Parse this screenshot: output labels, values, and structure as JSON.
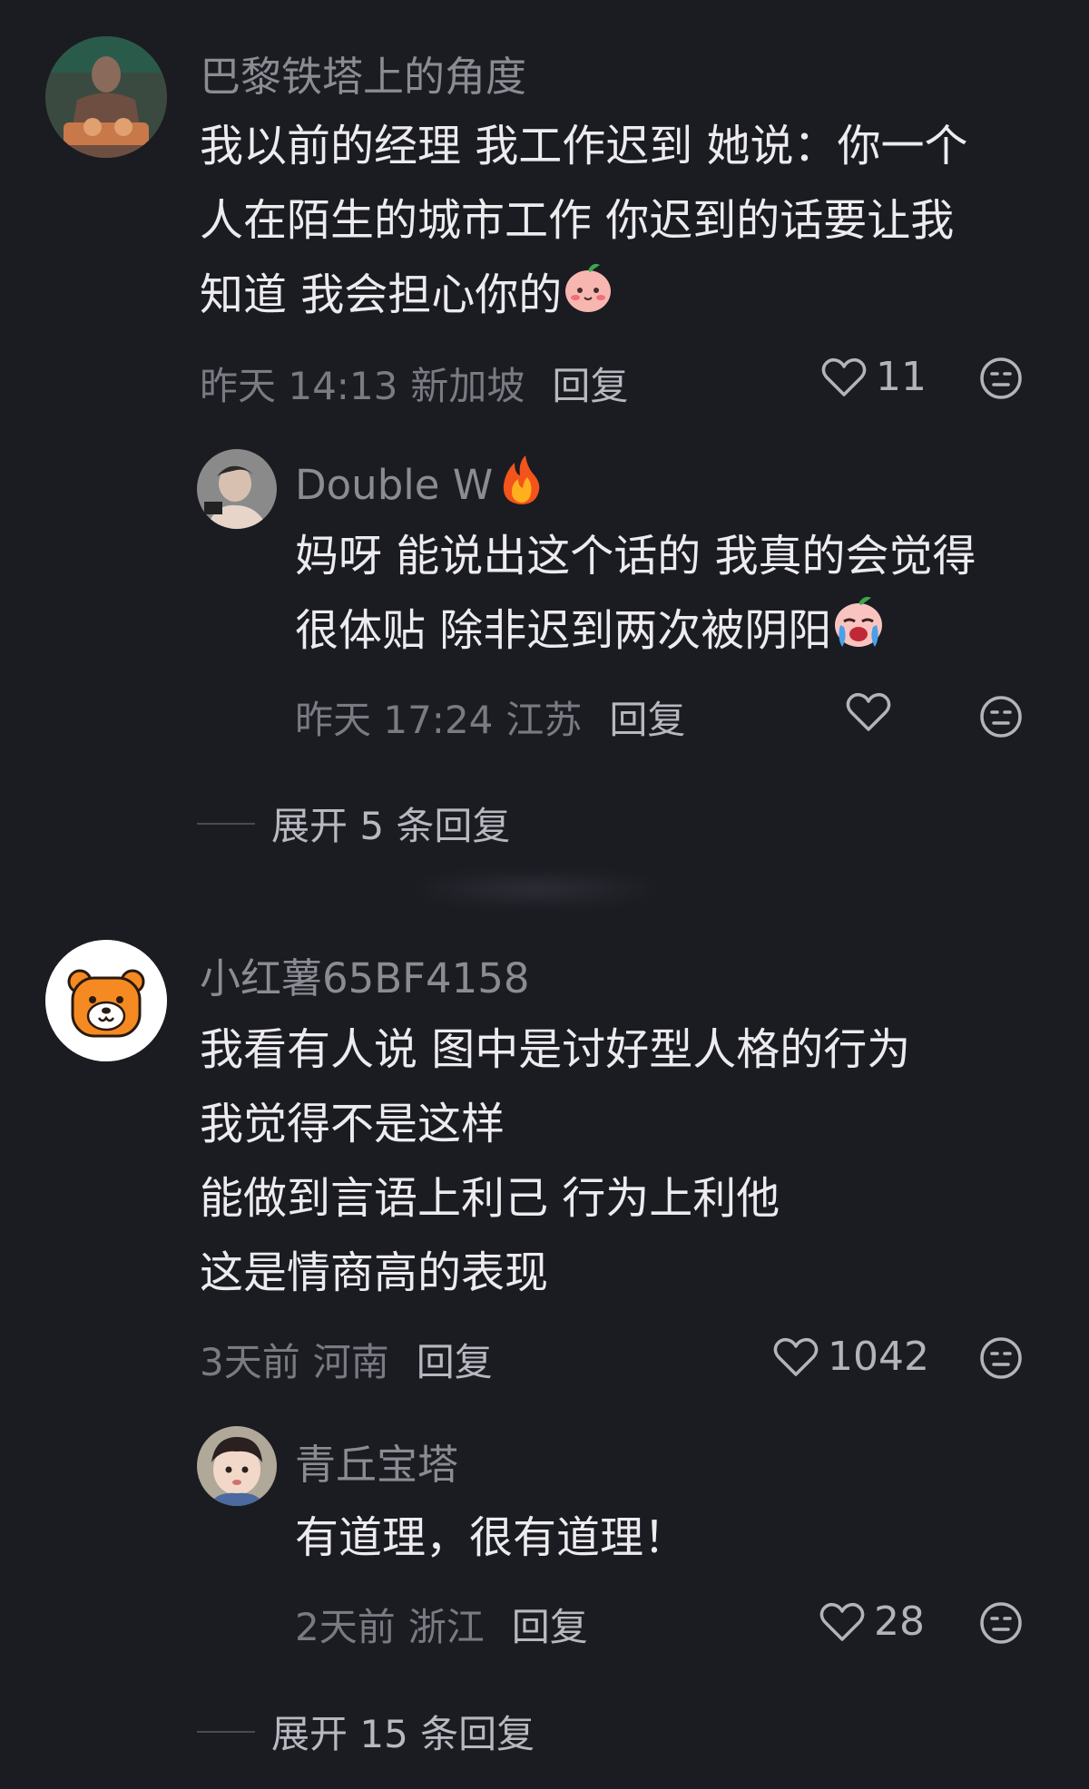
{
  "comments": [
    {
      "username": "巴黎铁塔上的角度",
      "avatar_icon": "person-eating-photo",
      "lines": [
        "我以前的经理 我工作迟到 她说：你一个",
        "人在陌生的城市工作 你迟到的话要让我",
        "知道 我会担心你的"
      ],
      "trailing_emoji": "blushing-peach-emoji",
      "time": "昨天 14:13",
      "location": "新加坡",
      "reply_label": "回复",
      "likes": "11",
      "reply": {
        "username": "Double W",
        "name_emoji": "fire-emoji",
        "avatar_icon": "person-photo",
        "lines": [
          "妈呀 能说出这个话的 我真的会觉得",
          "很体贴  除非迟到两次被阴阳"
        ],
        "trailing_emoji": "crying-laughing-emoji",
        "time": "昨天 17:24",
        "location": "江苏",
        "reply_label": "回复",
        "likes": ""
      },
      "expand_label": "展开 5 条回复"
    },
    {
      "username": "小红薯65BF4158",
      "avatar_icon": "bear-avatar",
      "lines": [
        "我看有人说 图中是讨好型人格的行为",
        "我觉得不是这样",
        "能做到言语上利己 行为上利他",
        "这是情商高的表现"
      ],
      "time": "3天前",
      "location": "河南",
      "reply_label": "回复",
      "likes": "1042",
      "reply": {
        "username": "青丘宝塔",
        "avatar_icon": "child-photo",
        "lines": [
          "有道理，很有道理！"
        ],
        "time": "2天前",
        "location": "浙江",
        "reply_label": "回复",
        "likes": "28"
      },
      "expand_label": "展开 15 条回复"
    }
  ],
  "colors": {
    "background": "#1b1b22",
    "text": "#ececef",
    "muted": "#7a7a83",
    "username": "#8b8b93"
  }
}
